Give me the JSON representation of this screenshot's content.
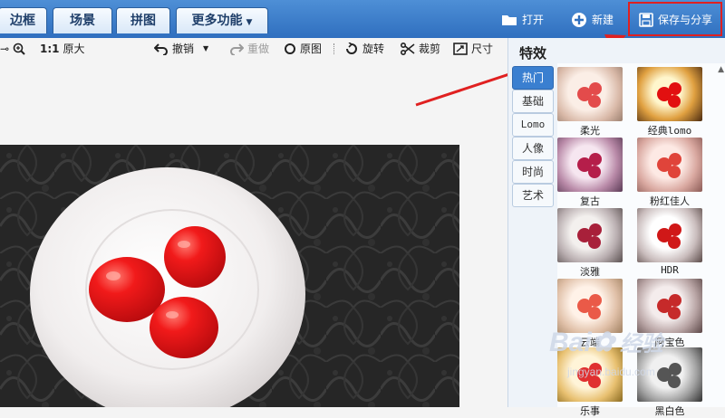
{
  "top_tabs": [
    {
      "label": "边框"
    },
    {
      "label": "场景"
    },
    {
      "label": "拼图"
    },
    {
      "label": "更多功能"
    }
  ],
  "top_actions": {
    "open": "打开",
    "new": "新建",
    "save_share": "保存与分享"
  },
  "toolbar": {
    "ratio": "1:1",
    "original_size": "原大",
    "undo": "撤销",
    "redo": "重做",
    "original_image": "原图",
    "rotate": "旋转",
    "crop": "裁剪",
    "size": "尺寸"
  },
  "panel": {
    "title": "特效",
    "categories": [
      {
        "label": "热门"
      },
      {
        "label": "基础"
      },
      {
        "label": "Lomo"
      },
      {
        "label": "人像"
      },
      {
        "label": "时尚"
      },
      {
        "label": "艺术"
      }
    ],
    "effects": [
      {
        "name": "柔光"
      },
      {
        "name": "经典lomo"
      },
      {
        "name": "复古"
      },
      {
        "name": "粉红佳人"
      },
      {
        "name": "淡雅"
      },
      {
        "name": "HDR"
      },
      {
        "name": "云端"
      },
      {
        "name": "阿宝色"
      },
      {
        "name": "乐事"
      },
      {
        "name": "黑白色"
      }
    ]
  },
  "watermark": {
    "brand": "Bai",
    "brand2": "经验",
    "url": "jingyan.baidu.com"
  },
  "colors": {
    "accent": "#2f6fbf",
    "highlight": "#e02020",
    "tomato": "#e0141a"
  }
}
